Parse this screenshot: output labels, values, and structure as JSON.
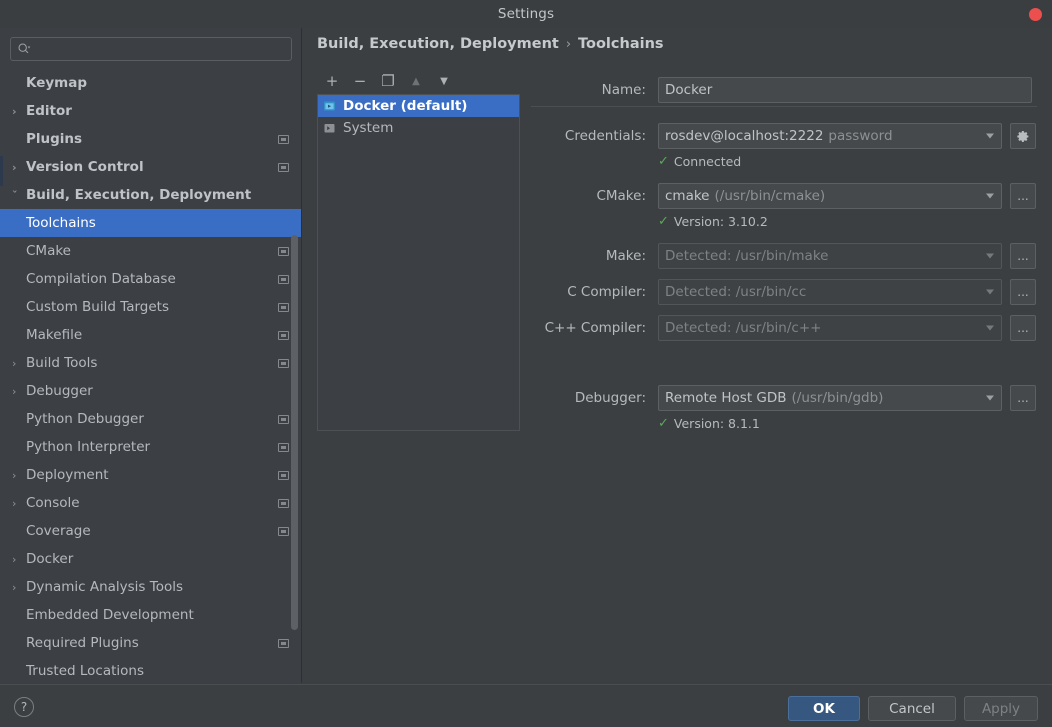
{
  "window": {
    "title": "Settings",
    "close_icon": "close-dot-icon"
  },
  "search": {
    "value": "",
    "placeholder": "",
    "icon": "search-icon"
  },
  "sidebar": {
    "items": [
      {
        "label": "Keymap",
        "level": 1,
        "bold": true,
        "chevron": "",
        "badge": false
      },
      {
        "label": "Editor",
        "level": 1,
        "bold": true,
        "chevron": "›",
        "badge": false
      },
      {
        "label": "Plugins",
        "level": 1,
        "bold": true,
        "chevron": "",
        "badge": true
      },
      {
        "label": "Version Control",
        "level": 1,
        "bold": true,
        "chevron": "›",
        "badge": true
      },
      {
        "label": "Build, Execution, Deployment",
        "level": 1,
        "bold": true,
        "chevron": "ˇ",
        "badge": false
      },
      {
        "label": "Toolchains",
        "level": 2,
        "bold": false,
        "chevron": "",
        "badge": false,
        "selected": true
      },
      {
        "label": "CMake",
        "level": 2,
        "bold": false,
        "chevron": "",
        "badge": true
      },
      {
        "label": "Compilation Database",
        "level": 2,
        "bold": false,
        "chevron": "",
        "badge": true
      },
      {
        "label": "Custom Build Targets",
        "level": 2,
        "bold": false,
        "chevron": "",
        "badge": true
      },
      {
        "label": "Makefile",
        "level": 2,
        "bold": false,
        "chevron": "",
        "badge": true
      },
      {
        "label": "Build Tools",
        "level": 2,
        "bold": false,
        "chevron": "›",
        "badge": true
      },
      {
        "label": "Debugger",
        "level": 2,
        "bold": false,
        "chevron": "›",
        "badge": false
      },
      {
        "label": "Python Debugger",
        "level": 2,
        "bold": false,
        "chevron": "",
        "badge": true
      },
      {
        "label": "Python Interpreter",
        "level": 2,
        "bold": false,
        "chevron": "",
        "badge": true
      },
      {
        "label": "Deployment",
        "level": 2,
        "bold": false,
        "chevron": "›",
        "badge": true
      },
      {
        "label": "Console",
        "level": 2,
        "bold": false,
        "chevron": "›",
        "badge": true
      },
      {
        "label": "Coverage",
        "level": 2,
        "bold": false,
        "chevron": "",
        "badge": true
      },
      {
        "label": "Docker",
        "level": 2,
        "bold": false,
        "chevron": "›",
        "badge": false
      },
      {
        "label": "Dynamic Analysis Tools",
        "level": 2,
        "bold": false,
        "chevron": "›",
        "badge": false
      },
      {
        "label": "Embedded Development",
        "level": 2,
        "bold": false,
        "chevron": "",
        "badge": false
      },
      {
        "label": "Required Plugins",
        "level": 2,
        "bold": false,
        "chevron": "",
        "badge": true
      },
      {
        "label": "Trusted Locations",
        "level": 2,
        "bold": false,
        "chevron": "",
        "badge": false
      }
    ]
  },
  "breadcrumb": {
    "root": "Build, Execution, Deployment",
    "separator": "›",
    "leaf": "Toolchains"
  },
  "toolchain_list": {
    "toolbar": [
      {
        "name": "add-toolchain-button",
        "glyph": "+",
        "disabled": false
      },
      {
        "name": "remove-toolchain-button",
        "glyph": "−",
        "disabled": false
      },
      {
        "name": "copy-toolchain-button",
        "glyph": "❐",
        "disabled": false
      },
      {
        "name": "move-up-button",
        "glyph": "▲",
        "disabled": true
      },
      {
        "name": "move-down-button",
        "glyph": "▼",
        "disabled": false
      }
    ],
    "items": [
      {
        "label": "Docker (default)",
        "icon": "docker-icon",
        "selected": true
      },
      {
        "label": "System",
        "icon": "system-terminal-icon",
        "selected": false
      }
    ]
  },
  "form": {
    "name": {
      "label": "Name:",
      "value": "Docker"
    },
    "credentials": {
      "label": "Credentials:",
      "value": "rosdev@localhost:2222",
      "value_muted": "password",
      "settings_icon": "gear-icon",
      "status": "Connected",
      "status_icon": "check-icon"
    },
    "cmake": {
      "label": "CMake:",
      "value": "cmake",
      "value_muted": "(/usr/bin/cmake)",
      "browse_label": "...",
      "status": "Version: 3.10.2",
      "status_icon": "check-icon"
    },
    "make": {
      "label": "Make:",
      "value": "Detected: /usr/bin/make",
      "browse_label": "...",
      "disabled": true
    },
    "c_compiler": {
      "label": "C Compiler:",
      "value": "Detected: /usr/bin/cc",
      "browse_label": "...",
      "disabled": true
    },
    "cxx_compiler": {
      "label": "C++ Compiler:",
      "value": "Detected: /usr/bin/c++",
      "browse_label": "...",
      "disabled": true
    },
    "debugger": {
      "label": "Debugger:",
      "value": "Remote Host GDB",
      "value_muted": "(/usr/bin/gdb)",
      "browse_label": "...",
      "status": "Version: 8.1.1",
      "status_icon": "check-icon"
    }
  },
  "footer": {
    "help_label": "?",
    "ok_label": "OK",
    "cancel_label": "Cancel",
    "apply_label": "Apply"
  },
  "colors": {
    "accent_blue": "#3a6ec5",
    "primary_button": "#365880",
    "success_green": "#5aa95a",
    "close_red": "#ed4f4f",
    "panel_bg": "#3c3f41",
    "sidebar_bg": "#3c4044"
  }
}
